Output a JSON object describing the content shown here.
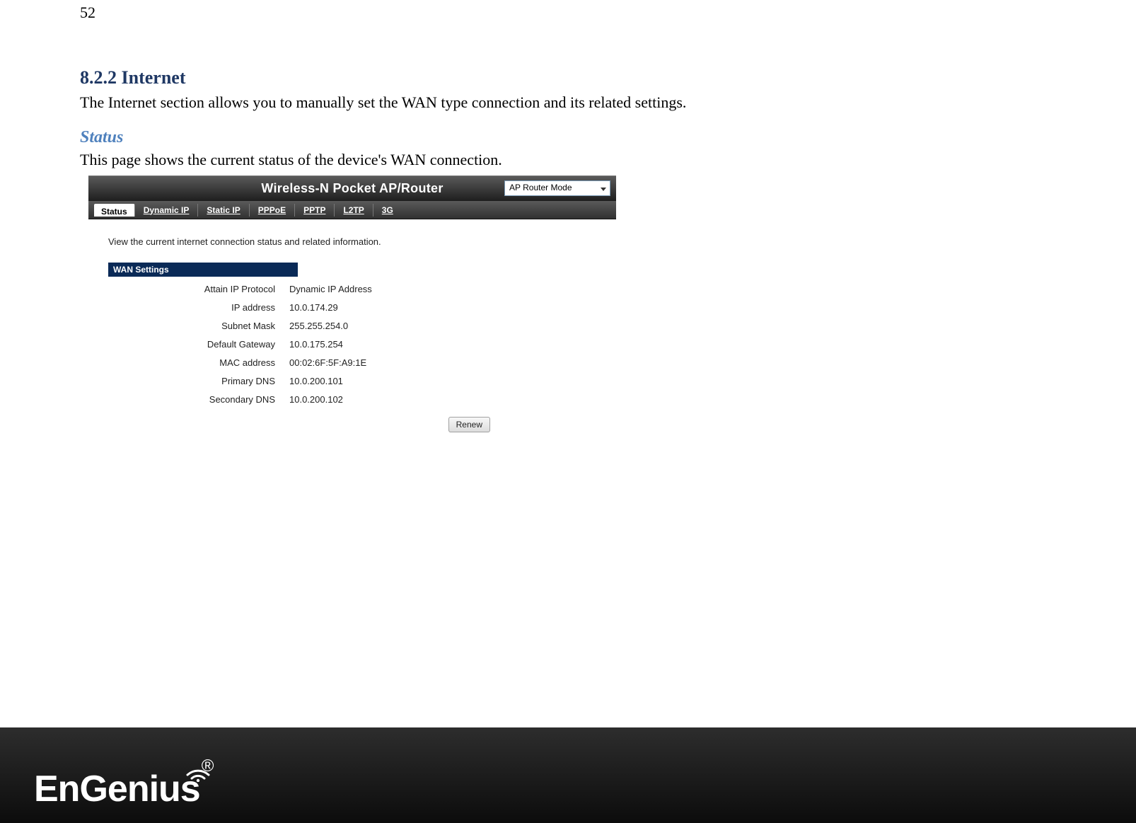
{
  "page_number": "52",
  "heading": "8.2.2 Internet",
  "intro_text": "The Internet section allows you to manually set the WAN type connection and its related settings.",
  "sub_heading": "Status",
  "sub_text": "This page shows the current status of the device's WAN connection.",
  "ui": {
    "title": "Wireless-N Pocket AP/Router",
    "mode_selected": "AP Router Mode",
    "tabs": [
      "Status",
      "Dynamic IP",
      "Static IP",
      "PPPoE",
      "PPTP",
      "L2TP",
      "3G"
    ],
    "active_tab_index": 0,
    "body_intro": "View the current internet connection status and related information.",
    "section_title": "WAN Settings",
    "rows": {
      "r0": {
        "label": "Attain IP Protocol",
        "value": "Dynamic IP Address"
      },
      "r1": {
        "label": "IP address",
        "value": "10.0.174.29"
      },
      "r2": {
        "label": "Subnet Mask",
        "value": "255.255.254.0"
      },
      "r3": {
        "label": "Default Gateway",
        "value": "10.0.175.254"
      },
      "r4": {
        "label": "MAC address",
        "value": "00:02:6F:5F:A9:1E"
      },
      "r5": {
        "label": "Primary DNS",
        "value": "10.0.200.101"
      },
      "r6": {
        "label": "Secondary DNS",
        "value": "10.0.200.102"
      }
    },
    "button_label": "Renew"
  },
  "footer": {
    "brand": "EnGenius",
    "reg": "®"
  }
}
